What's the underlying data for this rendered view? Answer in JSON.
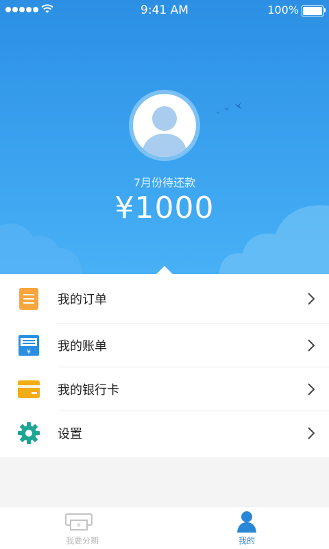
{
  "status_bar": {
    "time": "9:41 AM",
    "battery": "100%"
  },
  "hero": {
    "label": "7月份待还款",
    "amount": "¥1000"
  },
  "menu": {
    "items": [
      {
        "label": "我的订单",
        "icon": "order-icon",
        "icon_color": "#f7a53c"
      },
      {
        "label": "我的账单",
        "icon": "bill-icon",
        "icon_color": "#2b8ee2"
      },
      {
        "label": "我的银行卡",
        "icon": "bank-card-icon",
        "icon_color": "#f1ac16"
      },
      {
        "label": "设置",
        "icon": "settings-gear-icon",
        "icon_color": "#1ea593"
      }
    ]
  },
  "tabbar": {
    "tabs": [
      {
        "label": "我要分期",
        "icon": "installment-icon",
        "active": false
      },
      {
        "label": "我的",
        "icon": "profile-icon",
        "active": true
      }
    ]
  },
  "colors": {
    "primary": "#2c8fe3",
    "active_tab": "#2a86d6",
    "inactive_tab": "#b9b9b9"
  }
}
